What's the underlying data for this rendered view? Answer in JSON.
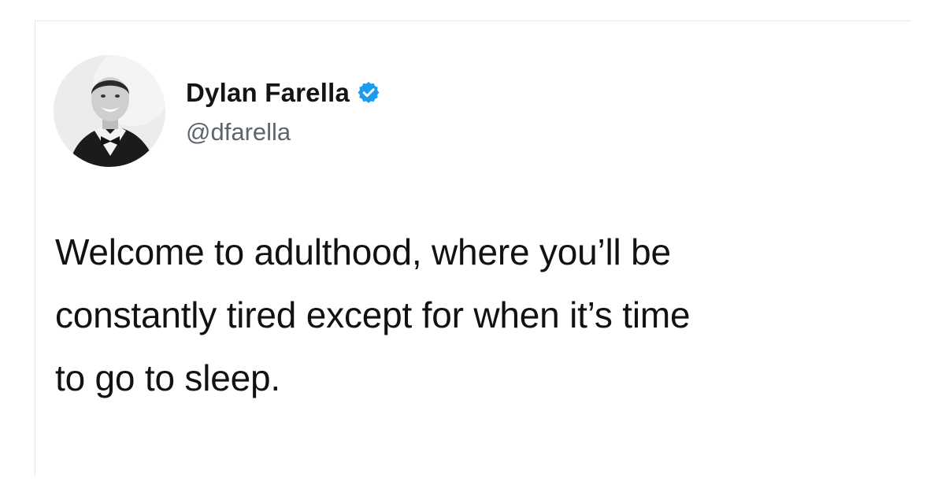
{
  "tweet": {
    "display_name": "Dylan Farella",
    "handle": "@dfarella",
    "verified": true,
    "text": "Welcome to adulthood, where you’ll be\nconstantly tired except for when it’s time\nto go to sleep."
  },
  "icons": {
    "avatar": "profile-photo",
    "badge": "verified-badge-icon"
  },
  "colors": {
    "verified": "#1d9bf0",
    "name": "#141414",
    "handle": "#5b6570",
    "text": "#121212"
  }
}
